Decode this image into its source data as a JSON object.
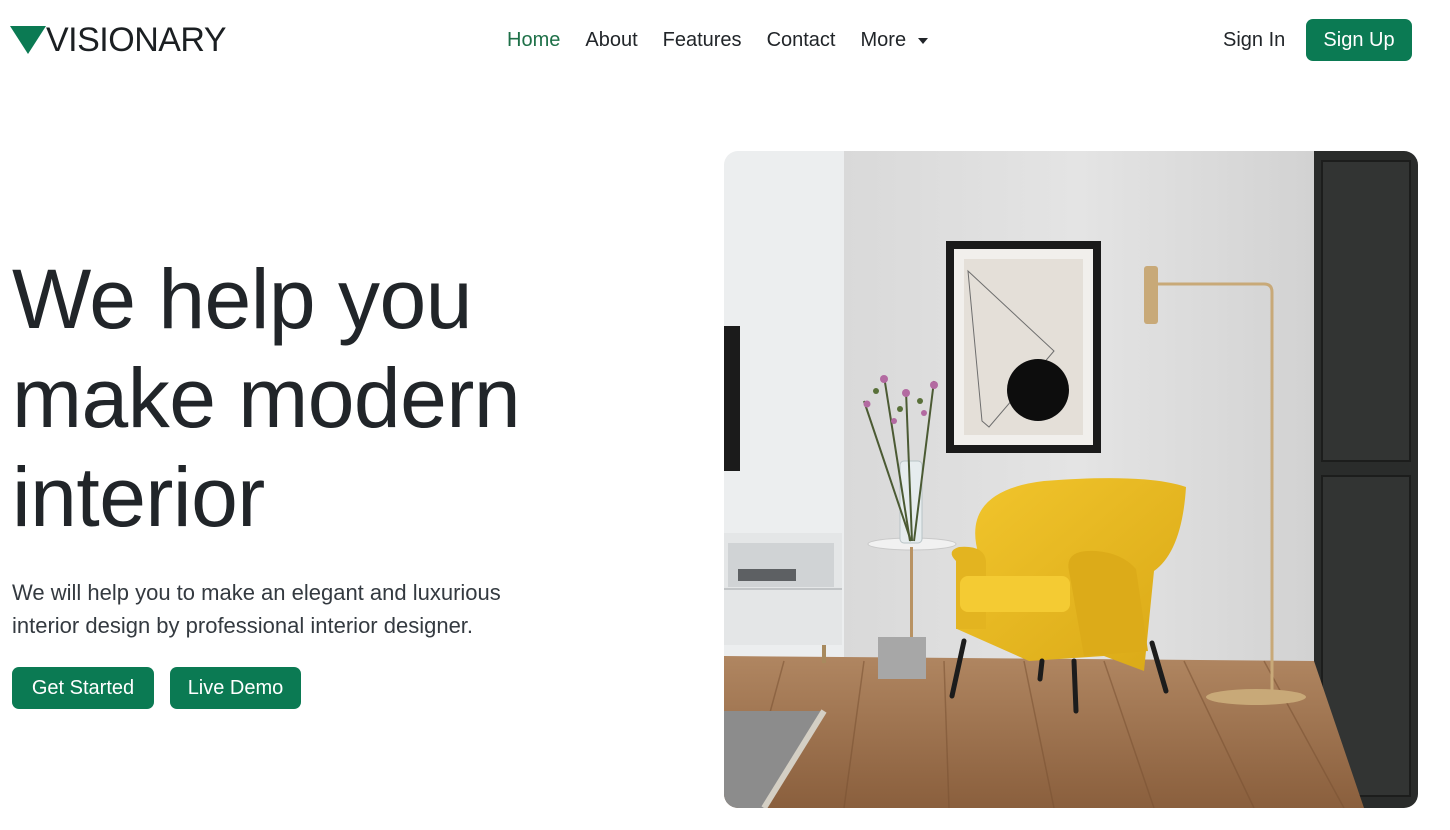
{
  "brand": {
    "name": "VISIONARY",
    "logo_icon": "triangle-logo-icon",
    "logo_color": "#0b7a53"
  },
  "nav": {
    "links": [
      {
        "label": "Home",
        "active": true
      },
      {
        "label": "About",
        "active": false
      },
      {
        "label": "Features",
        "active": false
      },
      {
        "label": "Contact",
        "active": false
      },
      {
        "label": "More",
        "active": false,
        "dropdown": true
      }
    ],
    "active_color": "#1e7048"
  },
  "auth": {
    "sign_in_label": "Sign In",
    "sign_up_label": "Sign Up"
  },
  "hero": {
    "title_lines": [
      "We help you",
      "make modern",
      "interior"
    ],
    "subtitle_lines": [
      "We will help you to make an elegant and luxurious",
      "interior design by professional interior designer."
    ],
    "primary_button": "Get Started",
    "secondary_button": "Live Demo",
    "image_description_icon": "room-photo-image"
  },
  "colors": {
    "accent": "#0b7a53",
    "text": "#212529"
  }
}
